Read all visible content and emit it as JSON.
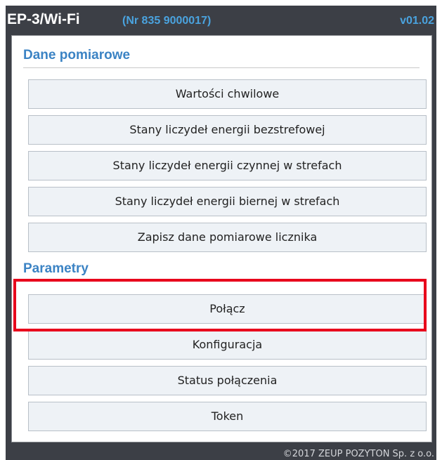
{
  "header": {
    "app_title": "EP-3/Wi-Fi",
    "device_nr": "(Nr 835 9000017)",
    "version": "v01.02"
  },
  "sections": {
    "measurements": {
      "title": "Dane pomiarowe",
      "items": [
        "Wartości chwilowe",
        "Stany liczydeł energii bezstrefowej",
        "Stany liczydeł energii czynnej w strefach",
        "Stany liczydeł energii biernej w strefach",
        "Zapisz dane pomiarowe licznika"
      ]
    },
    "parameters": {
      "title": "Parametry",
      "items": [
        "Połącz",
        "Konfiguracja",
        "Status połączenia",
        "Token"
      ]
    }
  },
  "footer": {
    "copyright": "©2017 ZEUP POZYTON Sp. z o.o."
  },
  "colors": {
    "frame_bg": "#3c3f46",
    "accent": "#4aa3df",
    "section_title": "#3b83c4",
    "button_bg": "#eef2f6",
    "highlight": "#e8001c"
  }
}
